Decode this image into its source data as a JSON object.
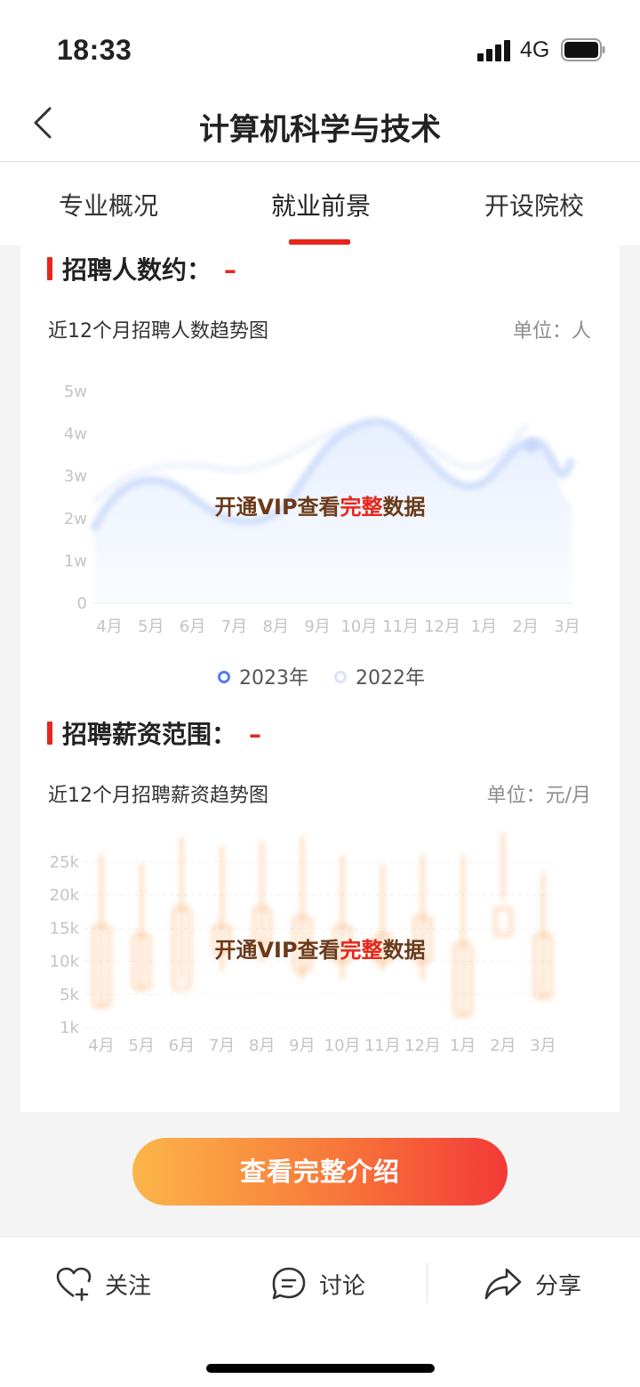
{
  "status_bar": {
    "time": "18:33",
    "network": "4G"
  },
  "nav": {
    "title": "计算机科学与技术"
  },
  "tabs": [
    {
      "label": "专业概况"
    },
    {
      "label": "就业前景"
    },
    {
      "label": "开设院校"
    }
  ],
  "recruit_count": {
    "heading": "招聘人数约：",
    "value": "–",
    "subtitle": "近12个月招聘人数趋势图",
    "unit": "单位：人",
    "overlay_pre": "开通VIP查看",
    "overlay_hl": "完整",
    "overlay_post": "数据",
    "legend": [
      {
        "label": "2023年"
      },
      {
        "label": "2022年"
      }
    ]
  },
  "salary": {
    "heading": "招聘薪资范围：",
    "value": "–",
    "subtitle": "近12个月招聘薪资趋势图",
    "unit": "单位：元/月",
    "overlay_pre": "开通VIP查看",
    "overlay_hl": "完整",
    "overlay_post": "数据"
  },
  "chart_data": [
    {
      "type": "area",
      "y_ticks": [
        "5w",
        "4w",
        "3w",
        "2w",
        "1w",
        "0"
      ],
      "categories": [
        "4月",
        "5月",
        "6月",
        "7月",
        "8月",
        "9月",
        "10月",
        "11月",
        "12月",
        "1月",
        "2月",
        "3月"
      ],
      "legend": [
        "2023年",
        "2022年"
      ],
      "colors": {
        "2023年": "#4f7ef0",
        "2022年": "#d4e2fb"
      }
    },
    {
      "type": "bar",
      "y_ticks": [
        "25k",
        "20k",
        "15k",
        "10k",
        "5k",
        "1k"
      ],
      "categories": [
        "4月",
        "5月",
        "6月",
        "7月",
        "8月",
        "9月",
        "10月",
        "11月",
        "12月",
        "1月",
        "2月",
        "3月"
      ],
      "color": "#f9a65b"
    }
  ],
  "cta": {
    "label": "查看完整介绍"
  },
  "bottom_bar": {
    "follow": "关注",
    "discuss": "讨论",
    "share": "分享"
  }
}
